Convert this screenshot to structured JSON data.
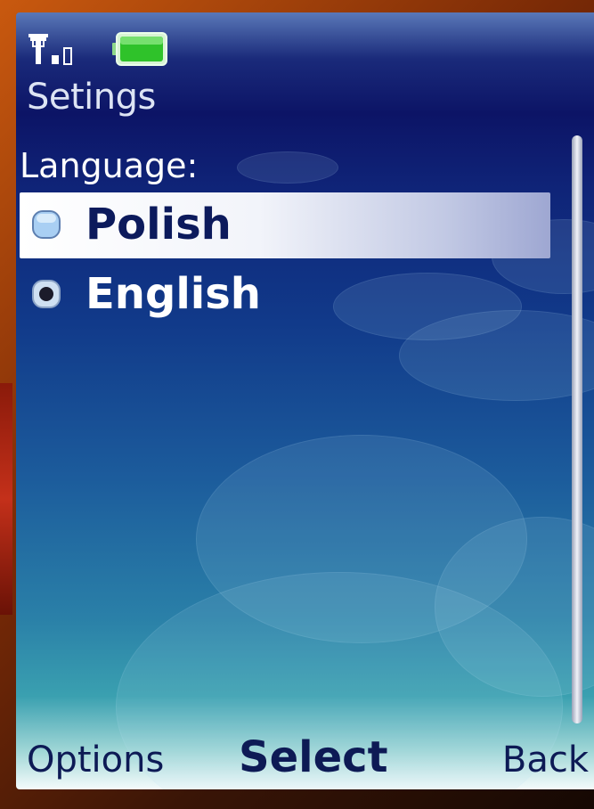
{
  "status_bar": {
    "signal_icon": "signal-strength-icon",
    "battery_icon": "battery-icon",
    "battery_color": "#2fc22a"
  },
  "screen": {
    "title": "Setings"
  },
  "list": {
    "header": "Language:",
    "options": [
      {
        "label": "Polish",
        "checked": false,
        "highlighted": true
      },
      {
        "label": "English",
        "checked": true,
        "highlighted": false
      }
    ]
  },
  "softkeys": {
    "left": "Options",
    "center": "Select",
    "right": "Back"
  },
  "colors": {
    "highlight_text": "#0c1a5c",
    "softkey_text": "#0d1a55",
    "radio_unchecked_fill": "#a9cff3"
  }
}
